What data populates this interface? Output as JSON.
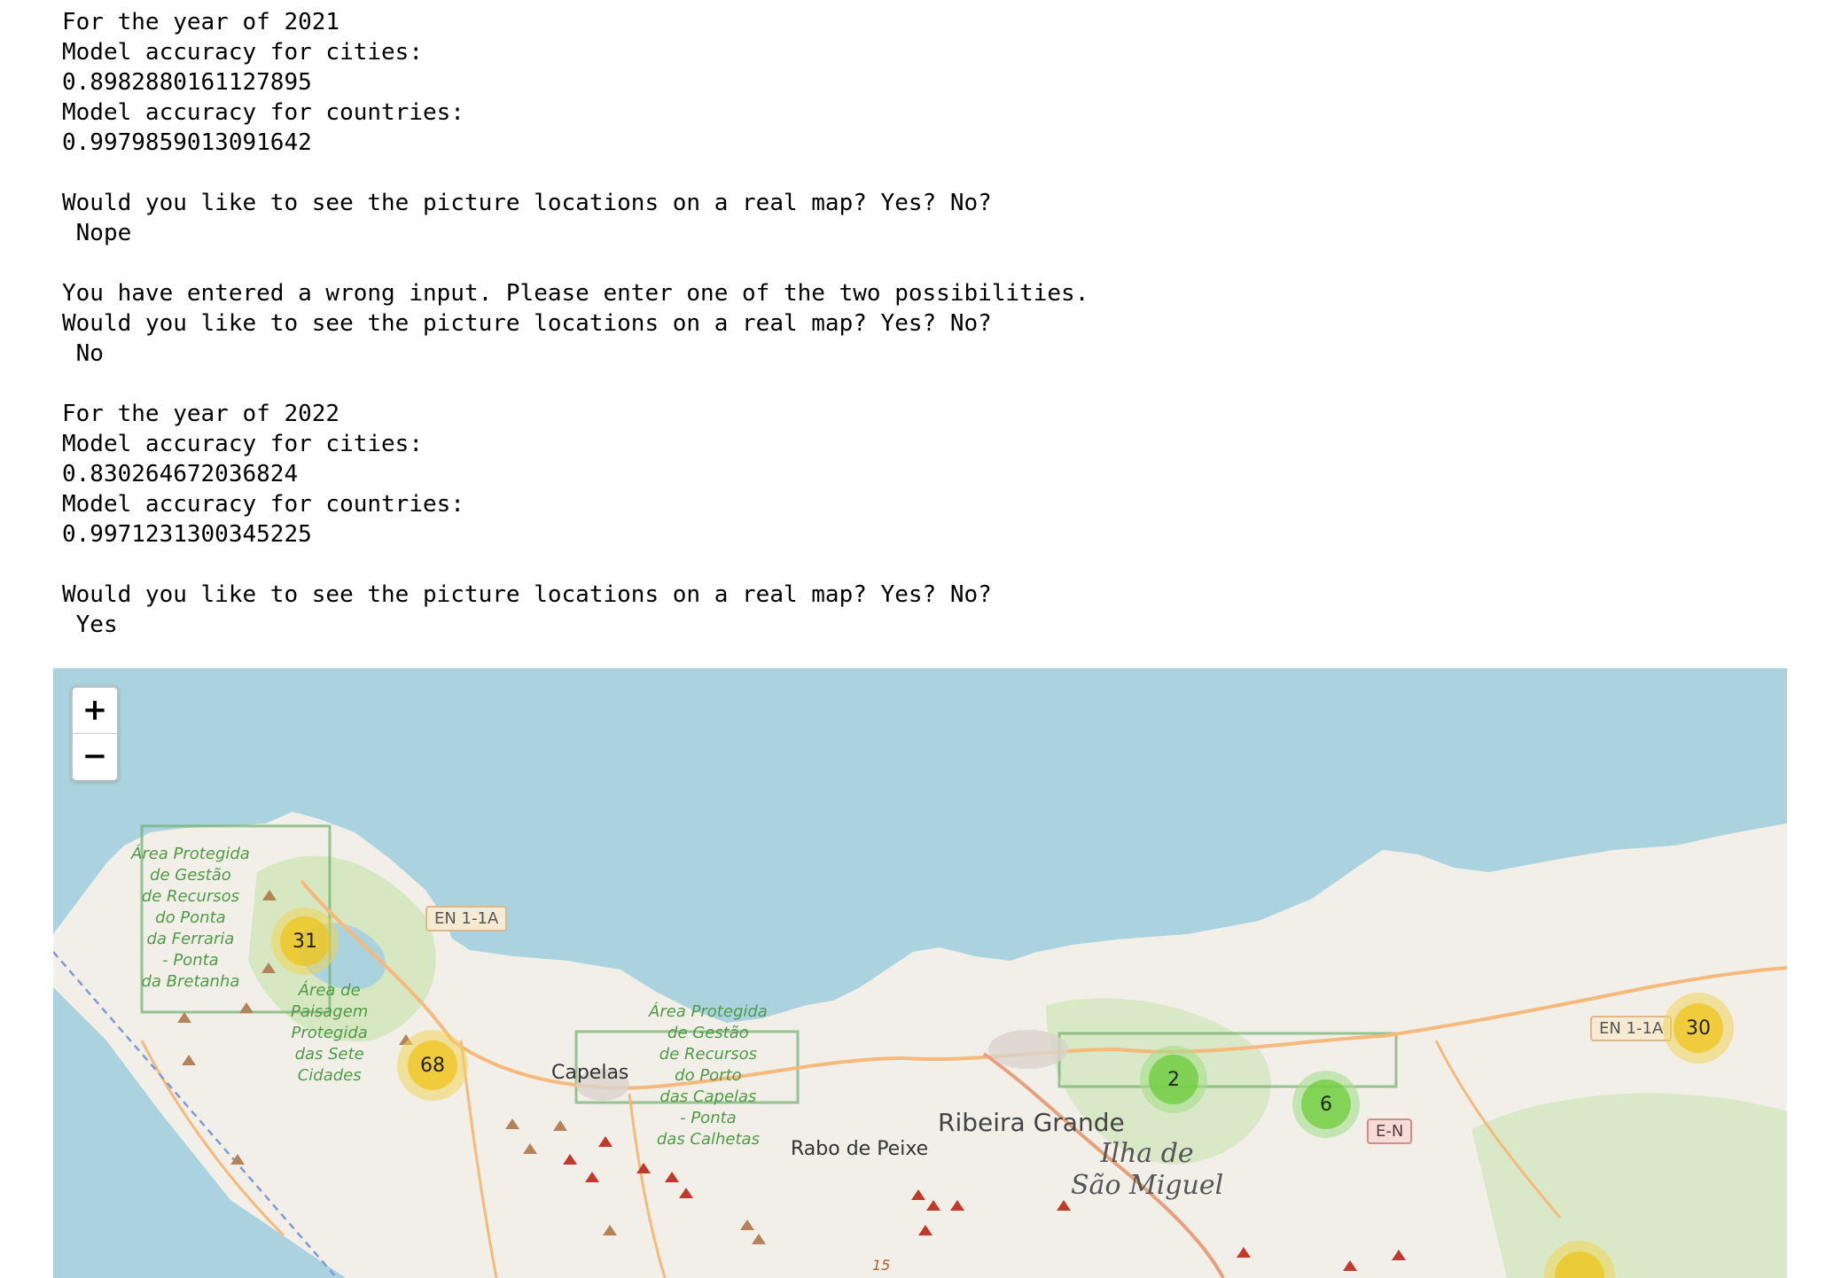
{
  "output_lines": [
    "For the year of 2021",
    "Model accuracy for cities:",
    "0.8982880161127895",
    "Model accuracy for countries:",
    "0.9979859013091642",
    "",
    "Would you like to see the picture locations on a real map? Yes? No?",
    " Nope",
    "",
    "You have entered a wrong input. Please enter one of the two possibilities.",
    "Would you like to see the picture locations on a real map? Yes? No?",
    " No",
    "",
    "For the year of 2022",
    "Model accuracy for cities:",
    "0.830264672036824",
    "Model accuracy for countries:",
    "0.9971231300345225",
    "",
    "Would you like to see the picture locations on a real map? Yes? No?",
    " Yes"
  ],
  "map": {
    "zoom_in_label": "+",
    "zoom_out_label": "−",
    "colors": {
      "sea": "#aad3df",
      "land": "#f2efe9",
      "park": "#c8e0b0",
      "park_border": "#6fae6a",
      "road": "#f6b97c",
      "peak": "#c0392b"
    },
    "clusters": [
      {
        "count": "31",
        "color": "yellow"
      },
      {
        "count": "68",
        "color": "yellow"
      },
      {
        "count": "2",
        "color": "green"
      },
      {
        "count": "6",
        "color": "green"
      },
      {
        "count": "30",
        "color": "yellow"
      }
    ],
    "places": {
      "capelas": "Capelas",
      "ribeira_grande": "Ribeira Grande",
      "rabo_de_peixe": "Rabo de Peixe",
      "island": "Ilha de\nSão Miguel"
    },
    "parks": {
      "ferraria": "Área Protegida\nde Gestão\nde Recursos\ndo Ponta\nda Ferraria\n- Ponta\nda Bretanha",
      "sete_cidades": "Área de\nPaisagem\nProtegida\ndas Sete\nCidades",
      "capelas": "Área Protegida\nde Gestão\nde Recursos\ndo Porto\ndas Capelas\n- Ponta\ndas Calhetas"
    },
    "road_shields": {
      "en_west": "EN 1-1A",
      "en_east": "EN 1-1A",
      "e_n": "E-N",
      "road_15": "15"
    }
  }
}
